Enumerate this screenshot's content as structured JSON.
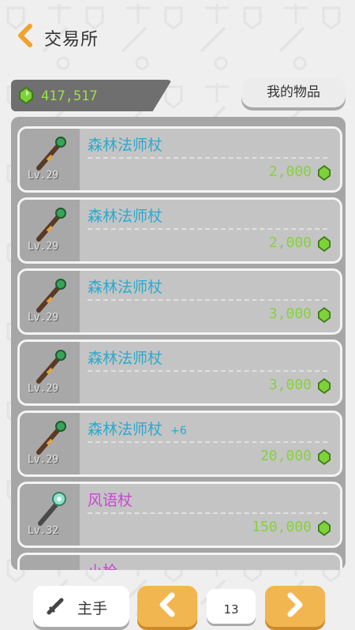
{
  "header": {
    "title": "交易所"
  },
  "currency": {
    "amount": "417,517"
  },
  "buttons": {
    "my_items": "我的物品"
  },
  "items": [
    {
      "name": "森林法师杖",
      "plus": "",
      "level": "Lv.29",
      "price": "2,000",
      "name_color": "#2ca9cc"
    },
    {
      "name": "森林法师杖",
      "plus": "",
      "level": "Lv.29",
      "price": "2,000",
      "name_color": "#2ca9cc"
    },
    {
      "name": "森林法师杖",
      "plus": "",
      "level": "Lv.29",
      "price": "3,000",
      "name_color": "#2ca9cc"
    },
    {
      "name": "森林法师杖",
      "plus": "",
      "level": "Lv.29",
      "price": "3,000",
      "name_color": "#2ca9cc"
    },
    {
      "name": "森林法师杖",
      "plus": "+6",
      "level": "Lv.29",
      "price": "20,000",
      "name_color": "#2ca9cc"
    },
    {
      "name": "风语杖",
      "plus": "",
      "level": "Lv.32",
      "price": "150,000",
      "name_color": "#c64ad0"
    },
    {
      "name": "小枪",
      "plus": "",
      "level": "",
      "price": "",
      "name_color": "#c64ad0"
    }
  ],
  "footer": {
    "main_hand_label": "主手",
    "page": "13"
  }
}
